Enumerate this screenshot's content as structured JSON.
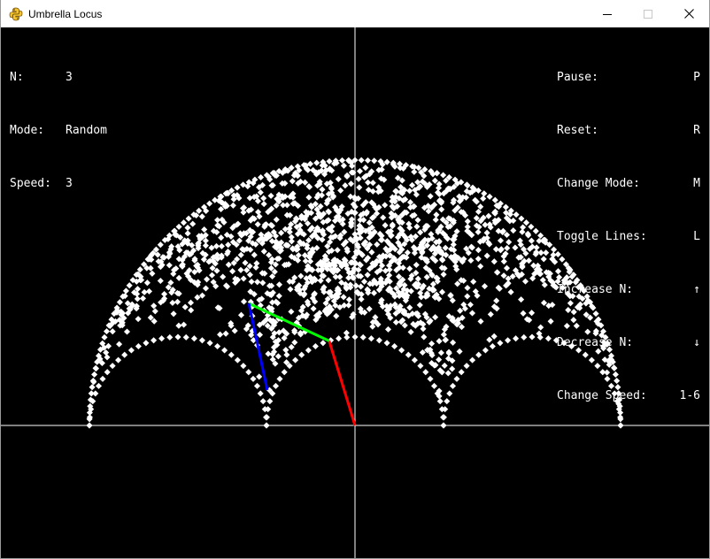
{
  "window": {
    "title": "Umbrella Locus",
    "icon": "python-snake-icon",
    "controls": [
      "minimize-icon",
      "maximize-icon",
      "close-icon"
    ]
  },
  "status": {
    "n_label": "N:",
    "n_value": "3",
    "mode_label": "Mode:",
    "mode_value": "Random",
    "speed_label": "Speed:",
    "speed_value": "3"
  },
  "controls_help": [
    {
      "label": "Pause:",
      "key": "P"
    },
    {
      "label": "Reset:",
      "key": "R"
    },
    {
      "label": "Change Mode:",
      "key": "M"
    },
    {
      "label": "Toggle Lines:",
      "key": "L"
    },
    {
      "label": "Increase N:",
      "key": "↑"
    },
    {
      "label": "Decrease N:",
      "key": "↓"
    },
    {
      "label": "Change Speed:",
      "key": "1-6"
    }
  ],
  "scene": {
    "n_segments": 3,
    "segment_colors": [
      "#ff0000",
      "#00ff00",
      "#0000ff"
    ],
    "segment_angles_deg": [
      107,
      155,
      282
    ],
    "point_color": "#ffffff",
    "axis_color": "#ffffff",
    "background": "#000000"
  }
}
